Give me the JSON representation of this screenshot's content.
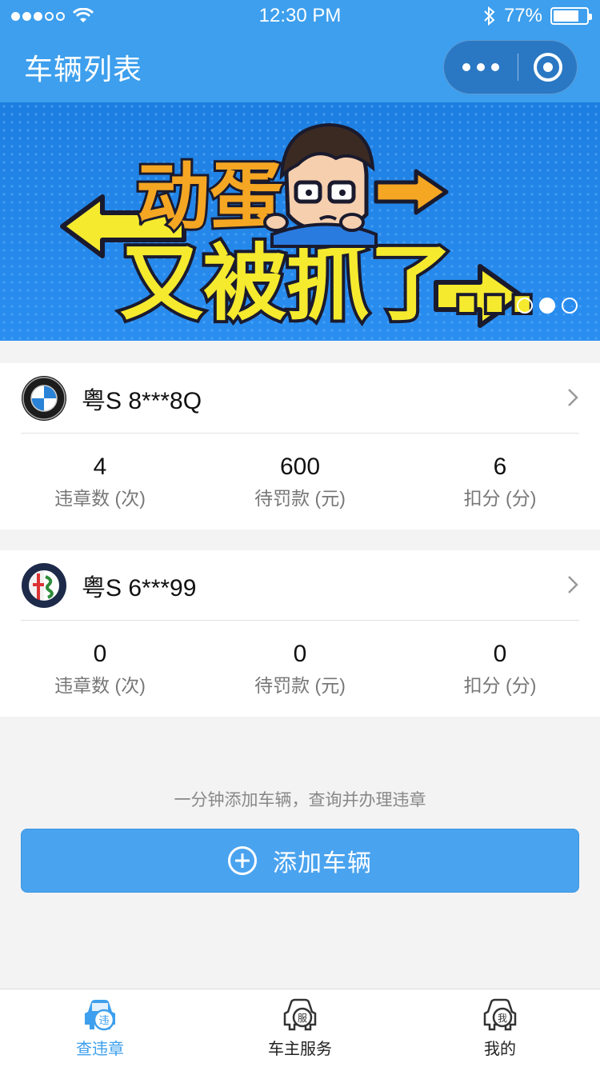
{
  "status_bar": {
    "time": "12:30 PM",
    "battery": "77%"
  },
  "nav": {
    "title": "车辆列表"
  },
  "banner": {
    "headline_line1": "动蛋",
    "headline_line2": "又被抓了…",
    "page_count": 3,
    "active_page": 2
  },
  "vehicles": [
    {
      "brand": "BMW",
      "plate": "粤S 8***8Q",
      "stats": [
        {
          "value": "4",
          "label": "违章数 (次)"
        },
        {
          "value": "600",
          "label": "待罚款 (元)"
        },
        {
          "value": "6",
          "label": "扣分 (分)"
        }
      ]
    },
    {
      "brand": "Alfa Romeo",
      "plate": "粤S 6***99",
      "stats": [
        {
          "value": "0",
          "label": "违章数 (次)"
        },
        {
          "value": "0",
          "label": "待罚款 (元)"
        },
        {
          "value": "0",
          "label": "扣分 (分)"
        }
      ]
    }
  ],
  "hint": "一分钟添加车辆，查询并办理违章",
  "add_button": {
    "label": "添加车辆"
  },
  "tabs": [
    {
      "label": "查违章",
      "icon_char": "违",
      "active": true
    },
    {
      "label": "车主服务",
      "icon_char": "服",
      "active": false
    },
    {
      "label": "我的",
      "icon_char": "我",
      "active": false
    }
  ],
  "colors": {
    "primary": "#3d9fed",
    "button": "#4aa3ef",
    "background": "#f3f3f3"
  }
}
